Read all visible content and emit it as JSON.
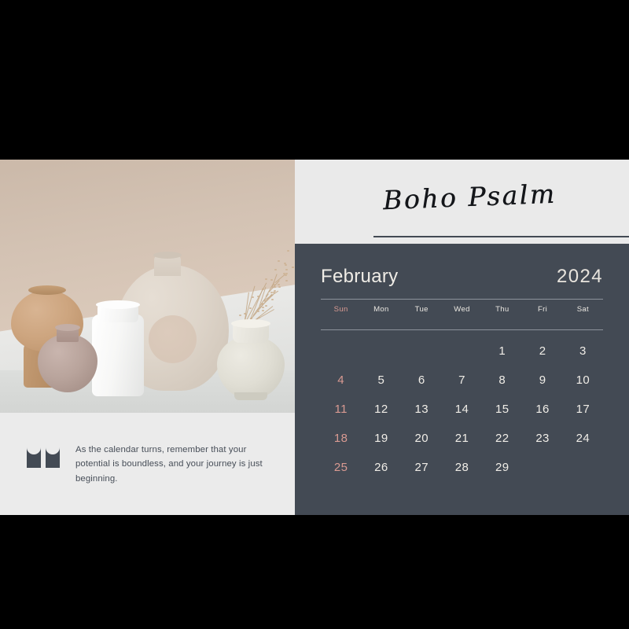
{
  "brand": {
    "title": "Boho Psalm"
  },
  "photo": {
    "alt_name": "boho-ceramic-vases-still-life",
    "wall_color": "#d3c2b3",
    "table_color": "#e4e5e3",
    "objects": [
      {
        "name": "cork-hourglass-vase",
        "color": "#c9a078"
      },
      {
        "name": "mauve-round-vase",
        "color": "#b5a099"
      },
      {
        "name": "white-glass-jar",
        "color": "#fbfbfa"
      },
      {
        "name": "donut-vase",
        "color": "#ded5ca"
      },
      {
        "name": "speckled-round-vase",
        "color": "#e0ded4"
      },
      {
        "name": "dried-branches",
        "color": "#c2a684"
      }
    ]
  },
  "quote": {
    "icon": "quotation-mark-icon",
    "text": "As the calendar turns, remember that your potential is boundless, and your journey is just beginning."
  },
  "calendar": {
    "month": "February",
    "year": "2024",
    "accent_color": "#d99a92",
    "panel_color": "#434a54",
    "weekdays": [
      "Sun",
      "Mon",
      "Tue",
      "Wed",
      "Thu",
      "Fri",
      "Sat"
    ],
    "first_day_index": 4,
    "days_in_month": 29,
    "weeks": [
      [
        "",
        "",
        "",
        "",
        "1",
        "2",
        "3"
      ],
      [
        "4",
        "5",
        "6",
        "7",
        "8",
        "9",
        "10"
      ],
      [
        "11",
        "12",
        "13",
        "14",
        "15",
        "16",
        "17"
      ],
      [
        "18",
        "19",
        "20",
        "21",
        "22",
        "23",
        "24"
      ],
      [
        "25",
        "26",
        "27",
        "28",
        "29",
        "",
        ""
      ]
    ]
  }
}
